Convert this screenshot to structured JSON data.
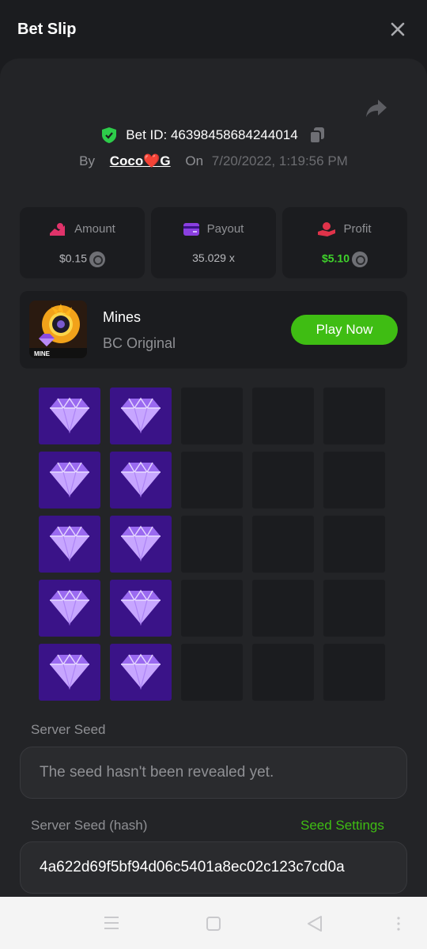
{
  "header": {
    "title": "Bet Slip"
  },
  "bet": {
    "id_label": "Bet ID: 46398458684244014",
    "by_label": "By",
    "username": "Coco❤️G",
    "on_label": "On",
    "date": "7/20/2022, 1:19:56 PM"
  },
  "stats": {
    "amount": {
      "label": "Amount",
      "value": "$0.15"
    },
    "payout": {
      "label": "Payout",
      "value": "35.029 x"
    },
    "profit": {
      "label": "Profit",
      "value": "$5.10"
    }
  },
  "game": {
    "name": "Mines",
    "subtitle": "BC Original",
    "thumb_text": "MINE",
    "play_label": "Play Now"
  },
  "grid": {
    "rows": 5,
    "cols": 5,
    "revealed_gem_columns": [
      0,
      1
    ]
  },
  "seeds": {
    "server_seed_label": "Server Seed",
    "server_seed_value": "The seed hasn't been revealed yet.",
    "hash_label": "Server Seed (hash)",
    "settings_link": "Seed Settings",
    "hash_value": "4a622d69f5bf94d06c5401a8ec02c123c7cd0a"
  },
  "colors": {
    "accent_green": "#3fbd13",
    "profit_green": "#3fd32b",
    "gem_tile": "#3a1388"
  }
}
